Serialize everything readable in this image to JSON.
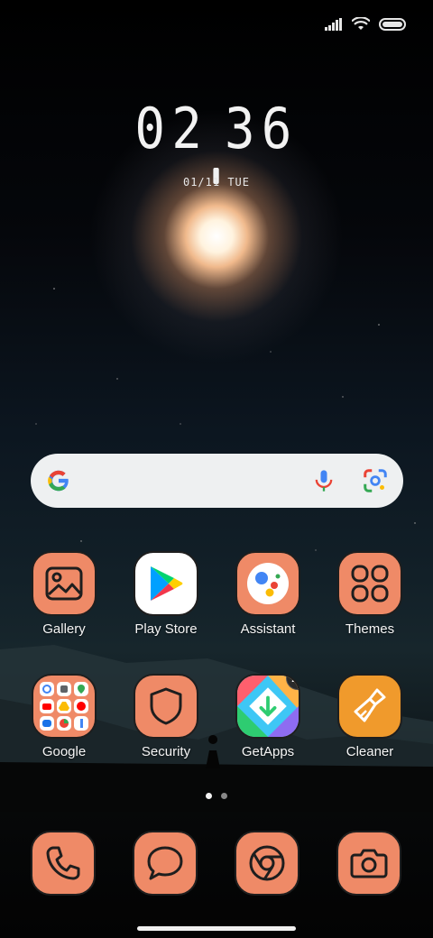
{
  "lockscreen": {
    "clock_h1": "0",
    "clock_h2": "2",
    "clock_m1": "3",
    "clock_m2": "6",
    "date": "01/11 TUE"
  },
  "status_bar": {
    "icons": [
      "signal-icon",
      "wifi-icon",
      "battery-icon"
    ]
  },
  "search": {
    "icons": [
      "google-g-icon",
      "microphone-icon",
      "google-lens-icon"
    ]
  },
  "apps_row1": [
    {
      "label": "Gallery",
      "icon": "gallery-icon"
    },
    {
      "label": "Play Store",
      "icon": "play-store-icon"
    },
    {
      "label": "Assistant",
      "icon": "assistant-icon"
    },
    {
      "label": "Themes",
      "icon": "themes-icon"
    }
  ],
  "apps_row2": [
    {
      "label": "Google",
      "icon": "google-folder-icon"
    },
    {
      "label": "Security",
      "icon": "security-shield-icon"
    },
    {
      "label": "GetApps",
      "icon": "getapps-icon",
      "badge": "28"
    },
    {
      "label": "Cleaner",
      "icon": "cleaner-broom-icon"
    }
  ],
  "dock": [
    {
      "icon": "phone-icon"
    },
    {
      "icon": "messages-icon"
    },
    {
      "icon": "chrome-icon"
    },
    {
      "icon": "camera-icon"
    }
  ],
  "pages": {
    "count": 2,
    "active": 1
  },
  "colors": {
    "icon_bg": "#ef8a67",
    "icon_border": "#1e1e1e",
    "search_bg": "#eef0f1",
    "cleaner_bg": "#f09a2c"
  }
}
